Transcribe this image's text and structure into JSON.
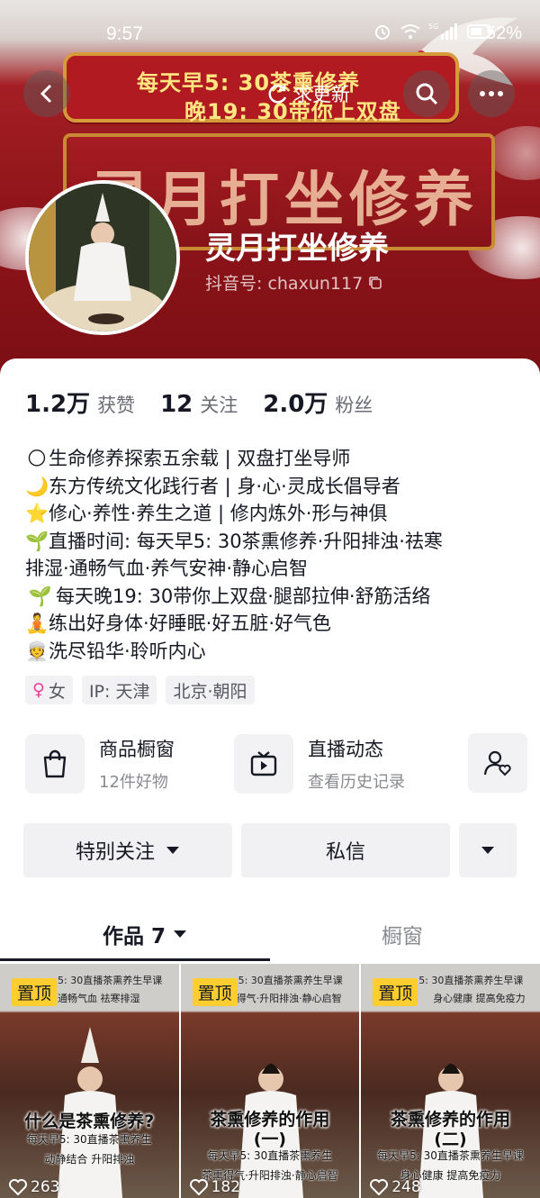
{
  "status_bar": {
    "time": "9:57",
    "battery": "52%",
    "signal_badge": "5G"
  },
  "banner": {
    "plaque_line1": "每天早5: 30茶熏修养",
    "plaque_line2": "晚19: 30带你上双盘",
    "big_title": "灵月打坐修养"
  },
  "nav": {
    "update_label": "求更新"
  },
  "profile": {
    "display_name": "灵月打坐修养",
    "account_id": "抖音号: chaxun117"
  },
  "stats": [
    {
      "value": "1.2万",
      "label": "获赞"
    },
    {
      "value": "12",
      "label": "关注"
    },
    {
      "value": "2.0万",
      "label": "粉丝"
    }
  ],
  "bio": [
    {
      "emoji": "🌕",
      "text": "生命修养探索五余载 | 双盘打坐导师"
    },
    {
      "emoji": "🌙",
      "text": "东方传统文化践行者 | 身·心·灵成长倡导者"
    },
    {
      "emoji": "⭐",
      "text": "修心·养性·养生之道 | 修内炼外·形与神俱"
    },
    {
      "emoji": "🌱",
      "text": "直播时间: 每天早5: 30茶熏修养·升阳排浊·祛寒"
    },
    {
      "emoji": "",
      "text": "排湿·通畅气血·养气安神·静心启智"
    },
    {
      "emoji": " 🌱",
      "text": "每天晚19: 30带你上双盘·腿部拉伸·舒筋活络"
    },
    {
      "emoji": "🧘",
      "text": "练出好身体·好睡眠·好五脏·好气色"
    },
    {
      "emoji": "👳",
      "text": "洗尽铅华·聆听内心"
    }
  ],
  "tags": {
    "gender": "女",
    "ip": "IP: 天津",
    "location": "北京·朝阳"
  },
  "entries": {
    "shop": {
      "title": "商品橱窗",
      "sub": "12件好物"
    },
    "live": {
      "title": "直播动态",
      "sub": "查看历史记录"
    }
  },
  "actions": {
    "special_follow": "特别关注",
    "message": "私信"
  },
  "tabs": {
    "works": "作品 7",
    "showcase": "橱窗"
  },
  "videos": [
    {
      "pin": "置顶",
      "top_caption": "5: 30直播茶熏养生早课",
      "top_caption2": "通畅气血  祛寒排湿",
      "title": "什么是茶熏修养?",
      "sub1": "每天早5: 30直播茶熏养生",
      "sub2": "动静结合        升阳排浊",
      "likes": "263"
    },
    {
      "pin": "置顶",
      "top_caption": "5: 30直播茶熏养生早课",
      "top_caption2": "茶熏得气·升阳排浊·静心启智",
      "title": "茶熏修养的作用",
      "title2": "(一)",
      "sub1": "每天早5: 30直播茶熏养生",
      "sub2": "茶熏得气·升阳排浊·静心启智",
      "likes": "182"
    },
    {
      "pin": "置顶",
      "top_caption": "5: 30直播茶熏养生早课",
      "top_caption2": "身心健康  提高免疫力",
      "title": "茶熏修养的作用",
      "title2": "(二)",
      "sub1": "每天早5: 30直播茶熏养生早课",
      "sub2": "身心健康  提高免疫力",
      "likes": "248"
    }
  ]
}
